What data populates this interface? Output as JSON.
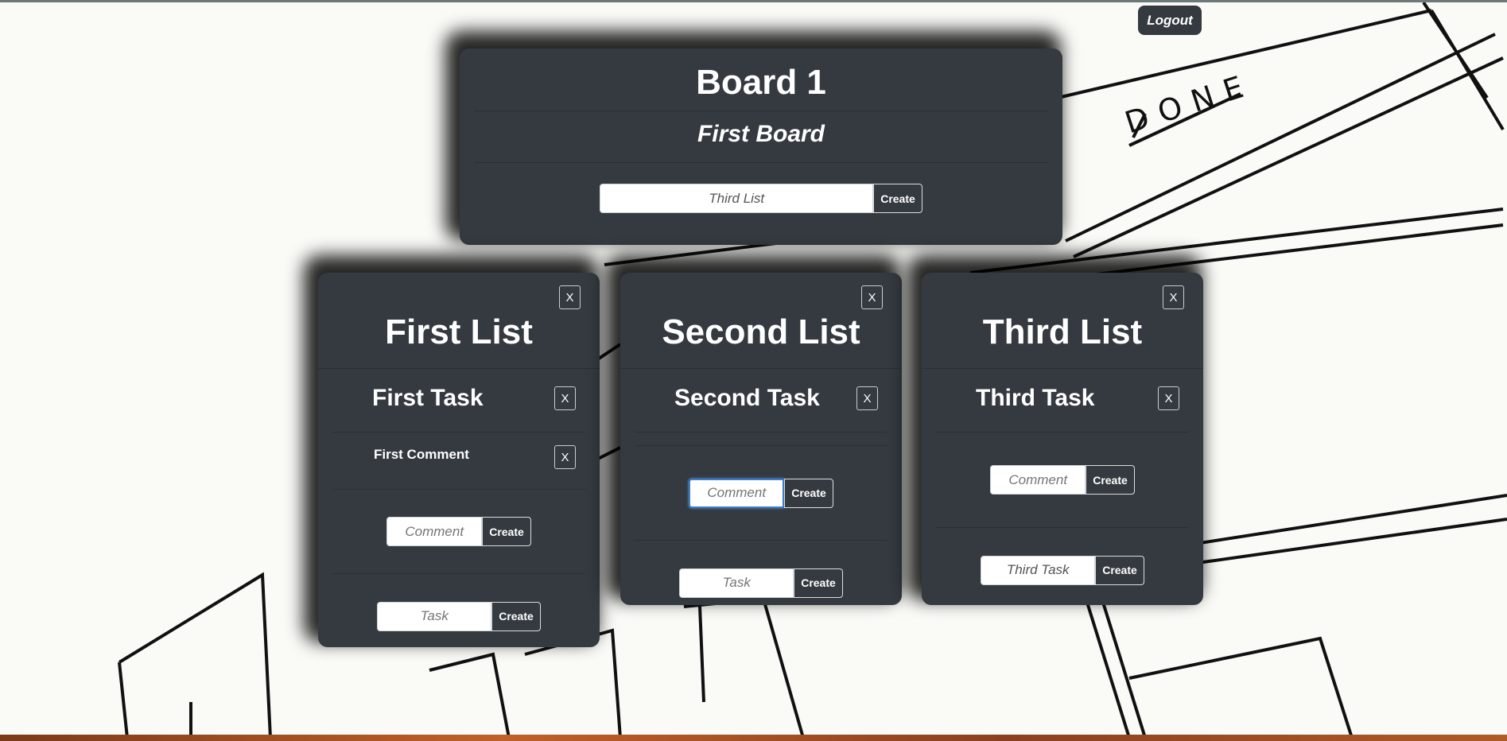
{
  "header": {
    "logout_label": "Logout"
  },
  "board": {
    "title": "Board 1",
    "description": "First Board",
    "list_input_value": "Third List",
    "create_label": "Create"
  },
  "lists": [
    {
      "title": "First List",
      "close_label": "X",
      "tasks": [
        {
          "title": "First Task",
          "close_label": "X",
          "comments": [
            {
              "text": "First Comment",
              "close_label": "X"
            }
          ],
          "comment_placeholder": "Comment",
          "create_label": "Create"
        }
      ],
      "task_placeholder": "Task",
      "task_value": "",
      "create_label": "Create"
    },
    {
      "title": "Second List",
      "close_label": "X",
      "tasks": [
        {
          "title": "Second Task",
          "close_label": "X",
          "comments": [],
          "comment_placeholder": "Comment",
          "create_label": "Create"
        }
      ],
      "task_placeholder": "Task",
      "task_value": "",
      "create_label": "Create"
    },
    {
      "title": "Third List",
      "close_label": "X",
      "tasks": [
        {
          "title": "Third Task",
          "close_label": "X",
          "comments": [],
          "comment_placeholder": "Comment",
          "create_label": "Create"
        }
      ],
      "task_placeholder": "Task",
      "task_value": "Third Task",
      "create_label": "Create"
    }
  ],
  "background": {
    "sketch_text": "DONE"
  },
  "colors": {
    "card": "#343a40",
    "background": "#fafaf7",
    "focus": "#3d7cc9"
  }
}
